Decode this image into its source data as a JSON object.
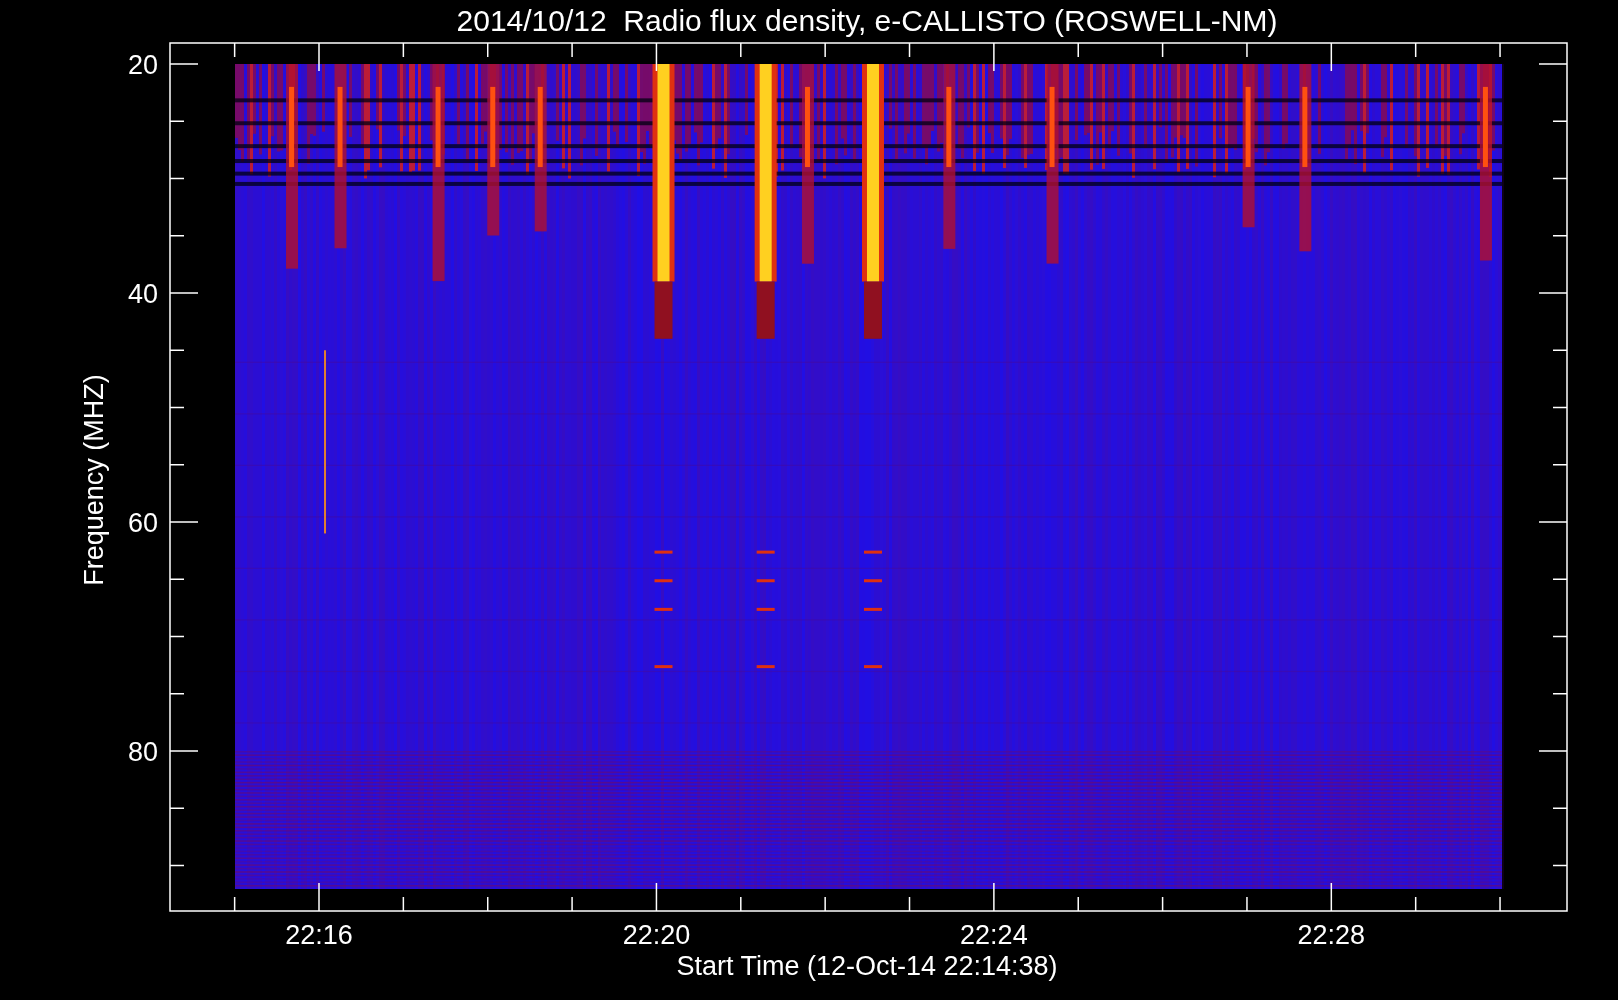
{
  "title": "2014/10/12  Radio flux density, e-CALLISTO (ROSWELL-NM)",
  "y_axis": {
    "label": "Frequency (MHZ)",
    "ticks": [
      "20",
      "40",
      "60",
      "80"
    ]
  },
  "x_axis": {
    "label": "Start Time (12-Oct-14 22:14:38)",
    "ticks": [
      "22:16",
      "22:20",
      "22:24",
      "22:28"
    ]
  }
}
